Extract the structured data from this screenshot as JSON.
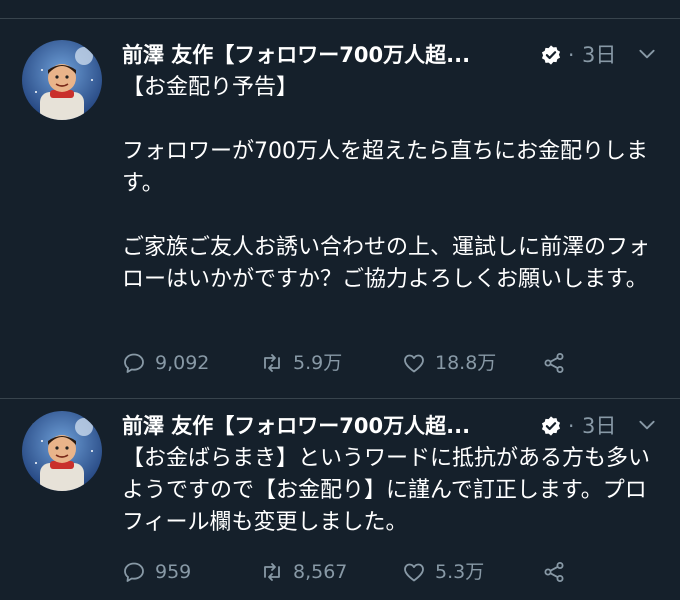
{
  "tweets": [
    {
      "author": "前澤 友作【フォロワー700万人超...",
      "time": "3日",
      "separator": "·",
      "text_lines": [
        "【お金配り予告】",
        "",
        "フォロワーが700万人を超えたら直ちにお金配り⁠します。",
        "",
        "ご家族ご友人お誘い合わせの上、運試しに前澤のフォローはいかがですか？ご協力よろしくお願いします。"
      ],
      "replies": "9,092",
      "retweets": "5.9万",
      "likes": "18.8万",
      "icons": [
        "reply-icon",
        "retweet-icon",
        "like-icon",
        "share-icon"
      ]
    },
    {
      "author": "前澤 友作【フォロワー700万人超...",
      "time": "3日",
      "separator": "·",
      "text_lines": [
        "【お金ばらまき】というワードに抵抗がある方も多いようですので【お金配り】に謹んで訂正します。プロフィール欄も変更しました。"
      ],
      "replies": "959",
      "retweets": "8,567",
      "likes": "5.3万",
      "icons": [
        "reply-icon",
        "retweet-icon",
        "like-icon",
        "share-icon"
      ]
    }
  ],
  "colors": {
    "background": "#15202b",
    "text": "#ffffff",
    "muted": "#8899a6",
    "divider": "#38444d"
  }
}
